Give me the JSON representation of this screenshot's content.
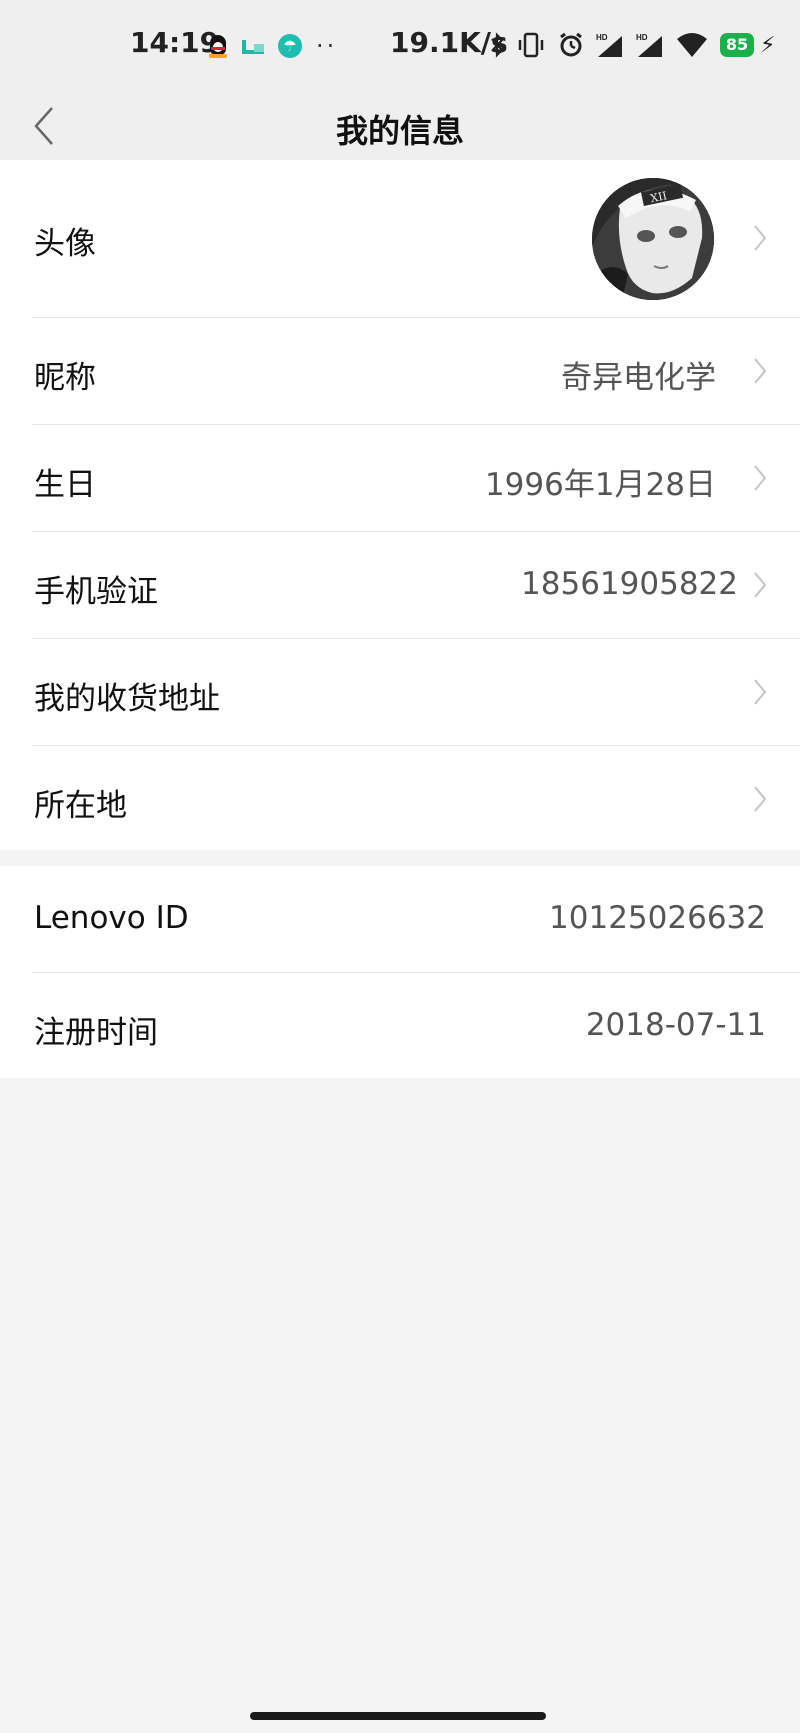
{
  "status_bar": {
    "time": "14:19",
    "network_speed": "19.1K/s",
    "battery_level": "85",
    "icons": [
      "qq-icon",
      "truck-icon",
      "umbrella-icon",
      "more-dots-icon",
      "bluetooth-icon",
      "vibrate-icon",
      "alarm-icon",
      "hd-signal-icon",
      "hd-signal-icon",
      "wifi-icon",
      "battery-icon",
      "charging-icon"
    ],
    "more_dots": "··",
    "umbrella_glyph": "☂",
    "bolt_glyph": "⚡"
  },
  "header": {
    "title": "我的信息",
    "back_icon": "back-chevron-icon"
  },
  "profile": {
    "rows": [
      {
        "label": "头像",
        "value": "",
        "kind": "avatar"
      },
      {
        "label": "昵称",
        "value": "奇异电化学"
      },
      {
        "label": "生日",
        "value": "1996年1月28日"
      },
      {
        "label": "手机验证",
        "value": "18561905822"
      },
      {
        "label": "我的收货地址",
        "value": ""
      },
      {
        "label": "所在地",
        "value": ""
      }
    ]
  },
  "account": {
    "rows": [
      {
        "label": "Lenovo ID",
        "value": "10125026632"
      },
      {
        "label": "注册时间",
        "value": "2018-07-11"
      }
    ]
  },
  "colors": {
    "background": "#f4f4f4",
    "card": "#ffffff",
    "battery": "#1cb04c",
    "accent_teal": "#1fbcb0"
  }
}
